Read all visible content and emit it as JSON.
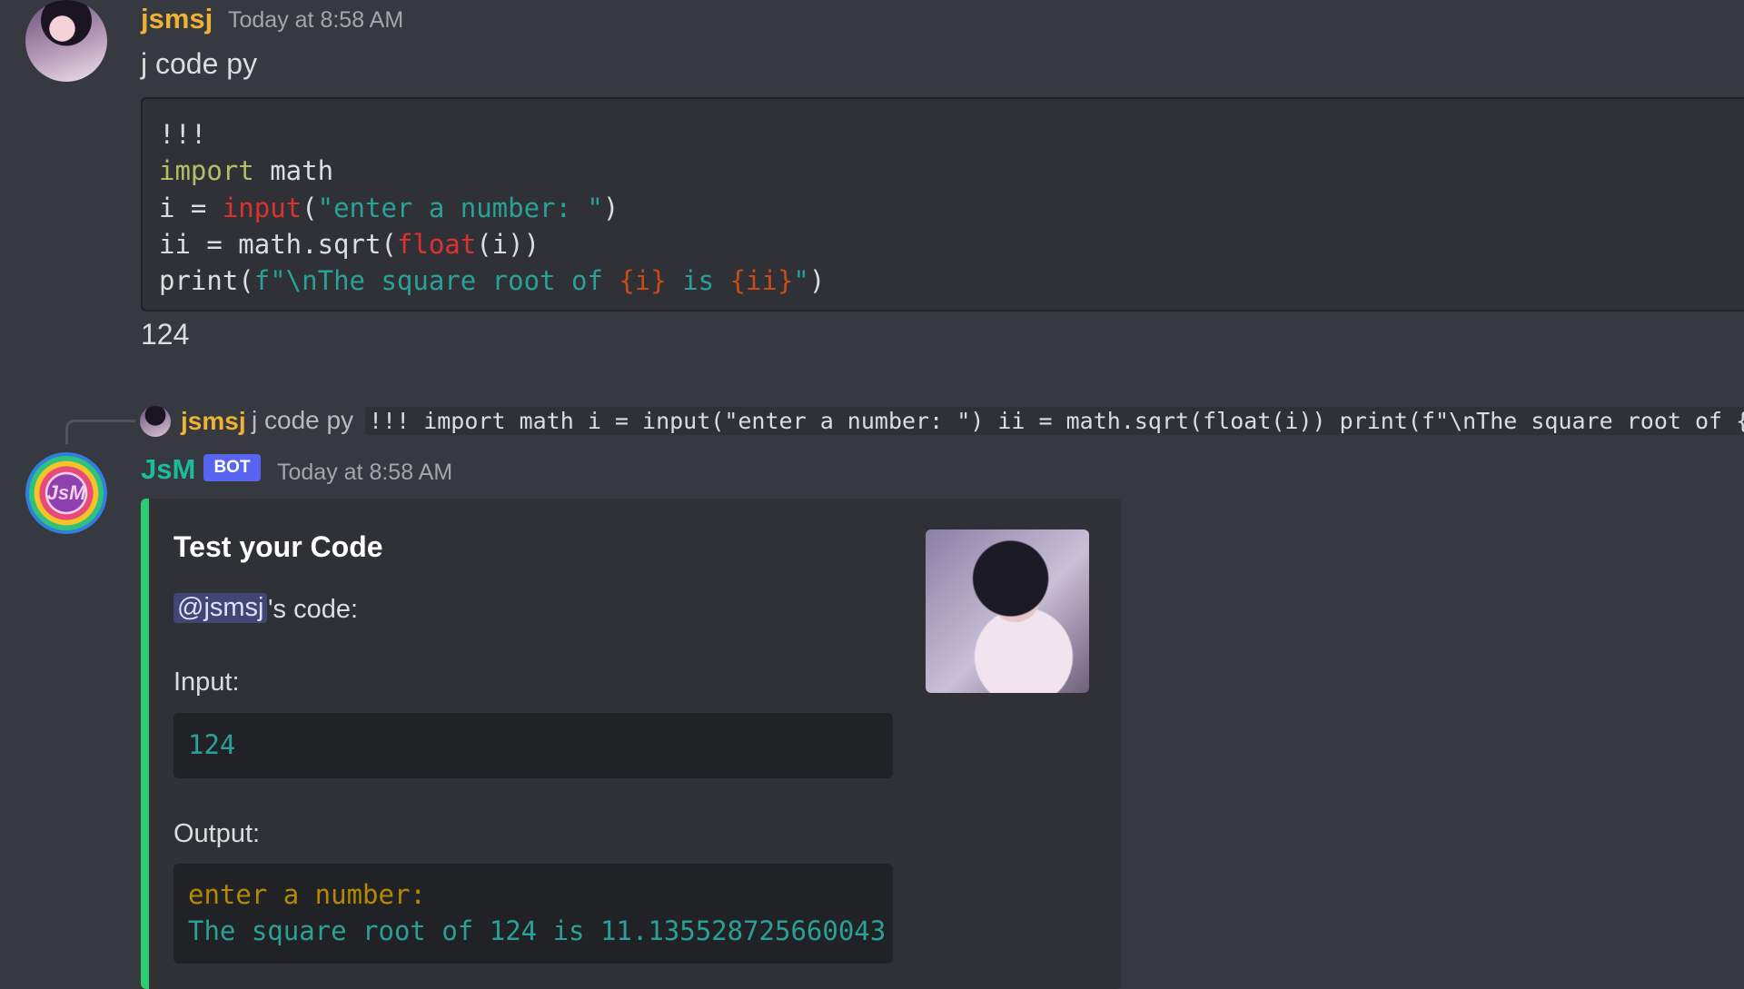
{
  "message1": {
    "username": "jsmsj",
    "username_color": "#f0b232",
    "timestamp": "Today at 8:58 AM",
    "text": "j code py",
    "code_lines": {
      "l1": "!!!",
      "l2_kw": "import",
      "l2_rest": " math",
      "l3_a": "i = ",
      "l3_fn": "input",
      "l3_b": "(",
      "l3_str": "\"enter a number: \"",
      "l3_c": ")",
      "l4_a": "ii = math.sqrt(",
      "l4_fn": "float",
      "l4_b": "(i))",
      "l5_a": "print(",
      "l5_str1": "f\"\\nThe square root of ",
      "l5_br1": "{i}",
      "l5_str2": " is ",
      "l5_br2": "{ii}",
      "l5_str3": "\"",
      "l5_b": ")"
    },
    "after_text": "124"
  },
  "reply": {
    "username": "jsmsj",
    "text": "j code py",
    "code_preview": "!!! import math i = input(\"enter a number: \") ii = math.sqrt(float(i)) print(f\"\\nThe square root of {i}"
  },
  "message2": {
    "username": "JsM",
    "username_color": "#1abc9c",
    "bot_tag": "BOT",
    "timestamp": "Today at 8:58 AM",
    "avatar_monogram": "JsM",
    "embed": {
      "accent_color": "#2ecc71",
      "title": "Test your Code",
      "mention": "@jsmsj",
      "mention_suffix": "'s code:",
      "input_label": "Input:",
      "input_value": "124",
      "output_label": "Output:",
      "output_line1": "enter a number:",
      "output_line2": "The square root of 124 is 11.135528725660043"
    }
  }
}
